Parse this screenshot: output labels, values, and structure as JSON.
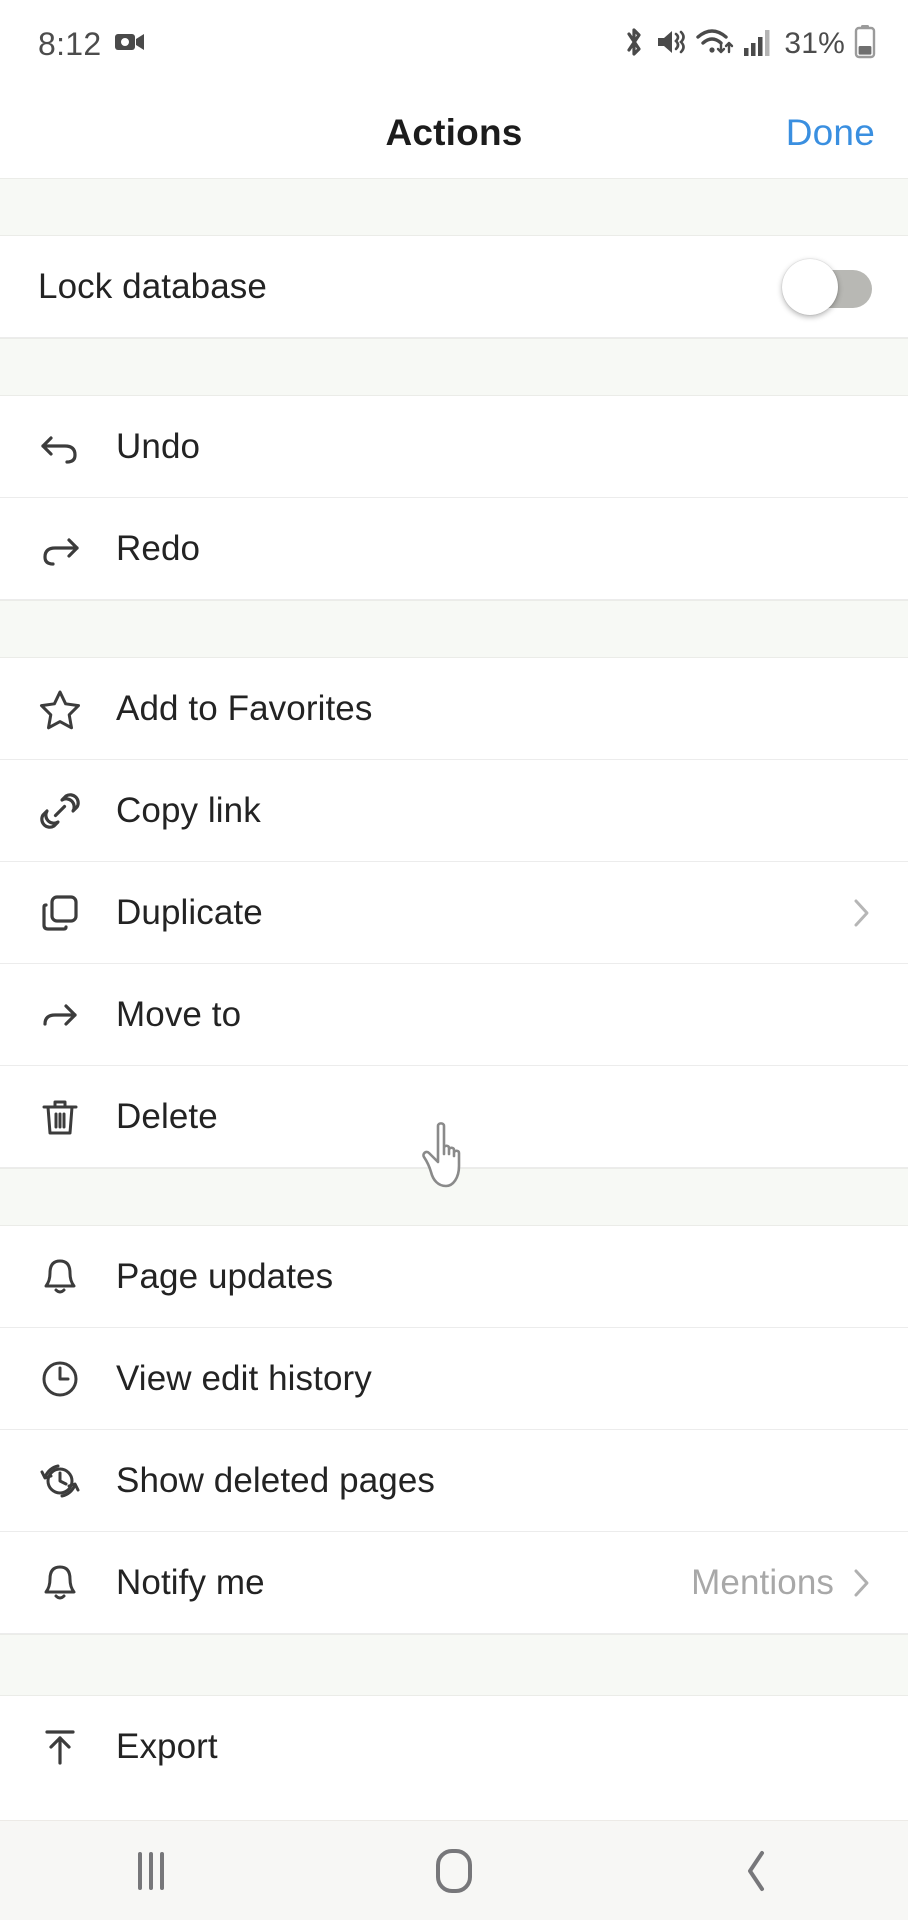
{
  "status_bar": {
    "time": "8:12",
    "battery_percent": "31%",
    "icons": [
      "screen-record-icon",
      "bluetooth-icon",
      "mute-vibrate-icon",
      "wifi-icon",
      "cellular-signal-icon",
      "battery-icon"
    ]
  },
  "header": {
    "title": "Actions",
    "done_label": "Done",
    "done_color": "#3a8fe0"
  },
  "sections": [
    {
      "name": "lock-section",
      "rows": [
        {
          "name": "lock-database",
          "label": "Lock database",
          "icon": null,
          "control": "toggle",
          "toggle_on": false
        }
      ]
    },
    {
      "name": "history-section",
      "rows": [
        {
          "name": "undo",
          "label": "Undo",
          "icon": "undo-arrow-icon",
          "control": null
        },
        {
          "name": "redo",
          "label": "Redo",
          "icon": "redo-arrow-icon",
          "control": null
        }
      ]
    },
    {
      "name": "page-actions-section",
      "rows": [
        {
          "name": "add-to-favorites",
          "label": "Add to Favorites",
          "icon": "star-icon",
          "control": null
        },
        {
          "name": "copy-link",
          "label": "Copy link",
          "icon": "link-icon",
          "control": null
        },
        {
          "name": "duplicate",
          "label": "Duplicate",
          "icon": "duplicate-icon",
          "control": "chevron"
        },
        {
          "name": "move-to",
          "label": "Move to",
          "icon": "move-arrow-icon",
          "control": null
        },
        {
          "name": "delete",
          "label": "Delete",
          "icon": "trash-icon",
          "control": null
        }
      ]
    },
    {
      "name": "updates-section",
      "rows": [
        {
          "name": "page-updates",
          "label": "Page updates",
          "icon": "bell-icon",
          "control": null
        },
        {
          "name": "view-edit-history",
          "label": "View edit history",
          "icon": "clock-icon",
          "control": null
        },
        {
          "name": "show-deleted-pages",
          "label": "Show deleted pages",
          "icon": "restore-clock-icon",
          "control": null
        },
        {
          "name": "notify-me",
          "label": "Notify me",
          "icon": "bell-icon",
          "control": "value-chevron",
          "value": "Mentions"
        }
      ]
    },
    {
      "name": "export-section",
      "rows": [
        {
          "name": "export",
          "label": "Export",
          "icon": "export-upload-icon",
          "control": null
        }
      ]
    }
  ],
  "nav_bar": {
    "recents_label": "recents-icon",
    "home_label": "home-icon",
    "back_label": "back-icon"
  },
  "cursor": {
    "type": "pointing-hand-cursor"
  }
}
